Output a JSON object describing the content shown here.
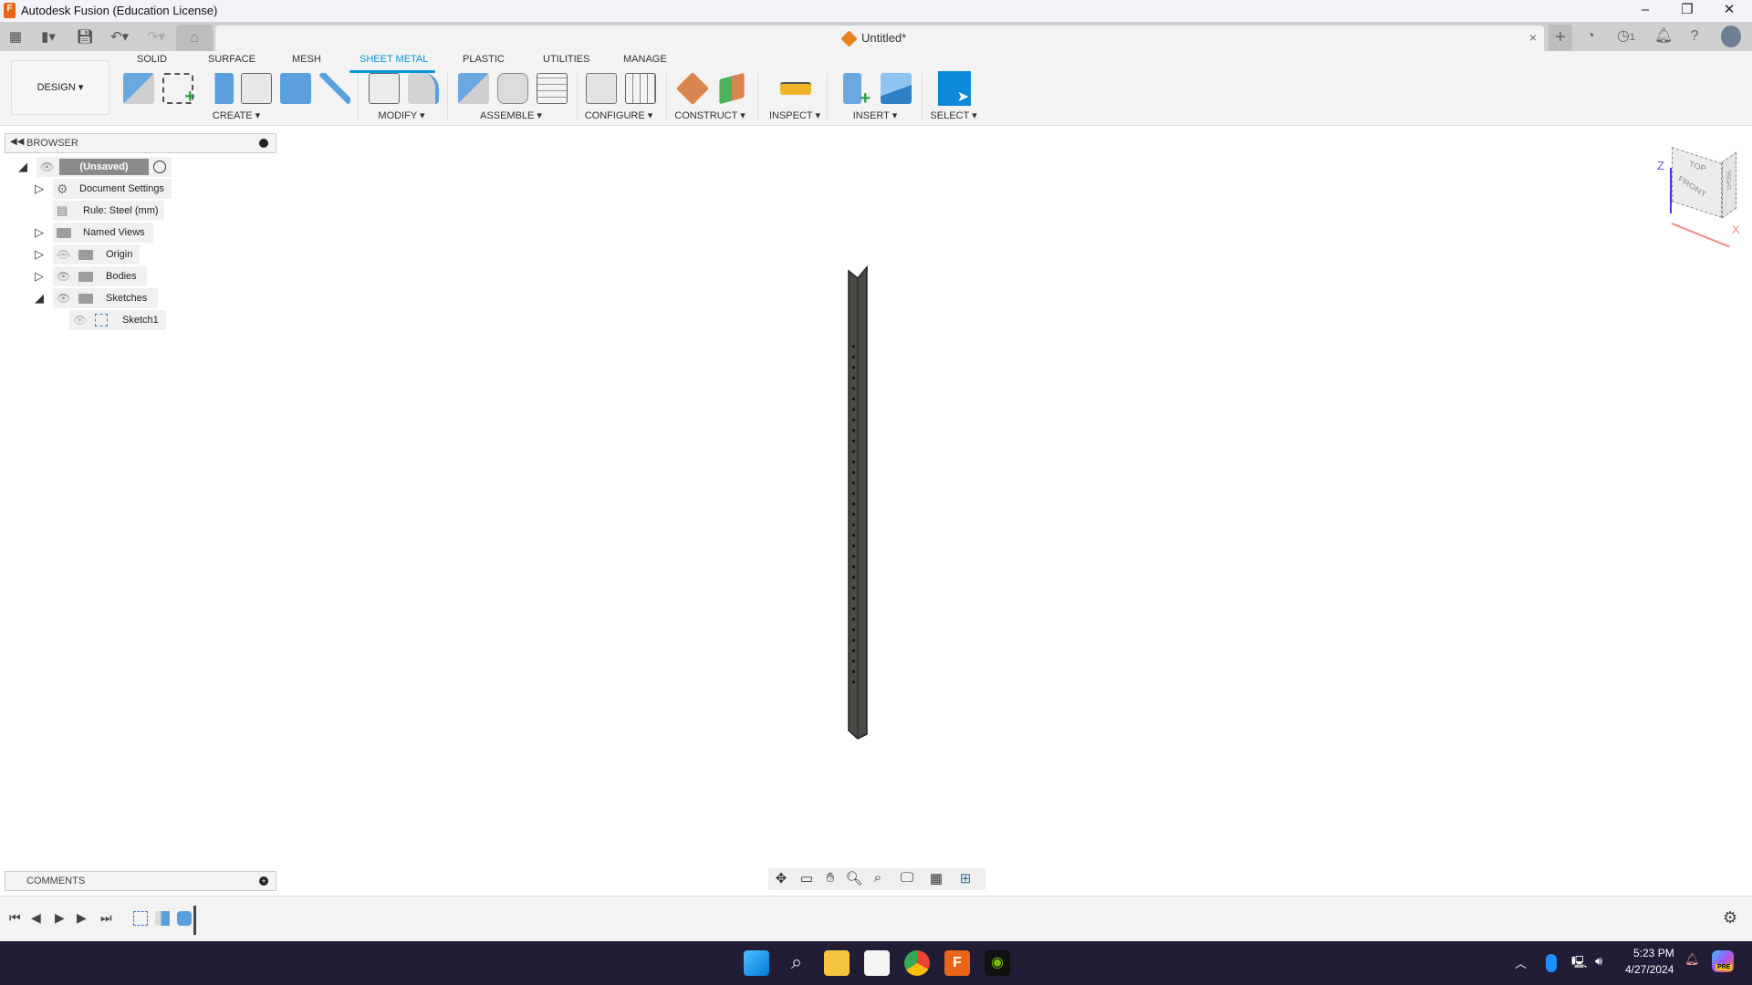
{
  "app": {
    "title": "Autodesk Fusion (Education License)",
    "logo_letter": "F"
  },
  "window_controls": {
    "minimize": "–",
    "restore": "❐",
    "close": "✕"
  },
  "document": {
    "tab_name": "Untitled*",
    "close": "×"
  },
  "header_right": {
    "job_count": "1"
  },
  "workspace": {
    "label": "DESIGN ▾"
  },
  "toolbar_tabs": [
    {
      "label": "SOLID"
    },
    {
      "label": "SURFACE"
    },
    {
      "label": "MESH"
    },
    {
      "label": "SHEET METAL",
      "active": true
    },
    {
      "label": "PLASTIC"
    },
    {
      "label": "UTILITIES"
    },
    {
      "label": "MANAGE"
    }
  ],
  "groups": [
    {
      "label": "CREATE ▾"
    },
    {
      "label": "MODIFY ▾"
    },
    {
      "label": "ASSEMBLE ▾"
    },
    {
      "label": "CONFIGURE ▾"
    },
    {
      "label": "CONSTRUCT ▾"
    },
    {
      "label": "INSPECT ▾"
    },
    {
      "label": "INSERT ▾"
    },
    {
      "label": "SELECT ▾"
    }
  ],
  "browser": {
    "title": "BROWSER",
    "items": [
      {
        "label": "(Unsaved)"
      },
      {
        "label": "Document Settings"
      },
      {
        "label": "Rule: Steel (mm)"
      },
      {
        "label": "Named Views"
      },
      {
        "label": "Origin"
      },
      {
        "label": "Bodies"
      },
      {
        "label": "Sketches"
      },
      {
        "label": "Sketch1"
      }
    ]
  },
  "comments": {
    "title": "COMMENTS"
  },
  "viewcube": {
    "top": "TOP",
    "front": "FRONT",
    "right": "RIGHT",
    "axis_z": "Z",
    "axis_x": "X"
  },
  "taskbar": {
    "time": "5:23 PM",
    "date": "4/27/2024",
    "copilot_badge": "PRE"
  },
  "colors": {
    "accent": "#0696d7",
    "fusion_orange": "#e8651a",
    "taskbar": "#201d35",
    "part": "#4a4a46"
  }
}
